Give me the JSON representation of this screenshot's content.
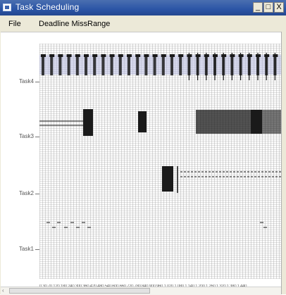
{
  "window": {
    "title": "Task Scheduling"
  },
  "titlebar_buttons": {
    "minimize": "_",
    "maximize": "□",
    "close": "X"
  },
  "menu": {
    "items": [
      "File",
      "Deadline Miss",
      "Range"
    ]
  },
  "tasks": [
    "Task4",
    "Task3",
    "Task2",
    "Task1"
  ],
  "x_axis": {
    "labels": "0 30 70 120 180 240 300 360 420 480 540 600 660 720 780 840 900 960 1 020 1 080 1 140 1 200 1 260 1 320 1 380 1 440"
  },
  "colors": {
    "titlebar": "#2b55a6",
    "job": "#1a1a1a",
    "deadline_miss": "#b8bce0",
    "grid": "#969696"
  }
}
